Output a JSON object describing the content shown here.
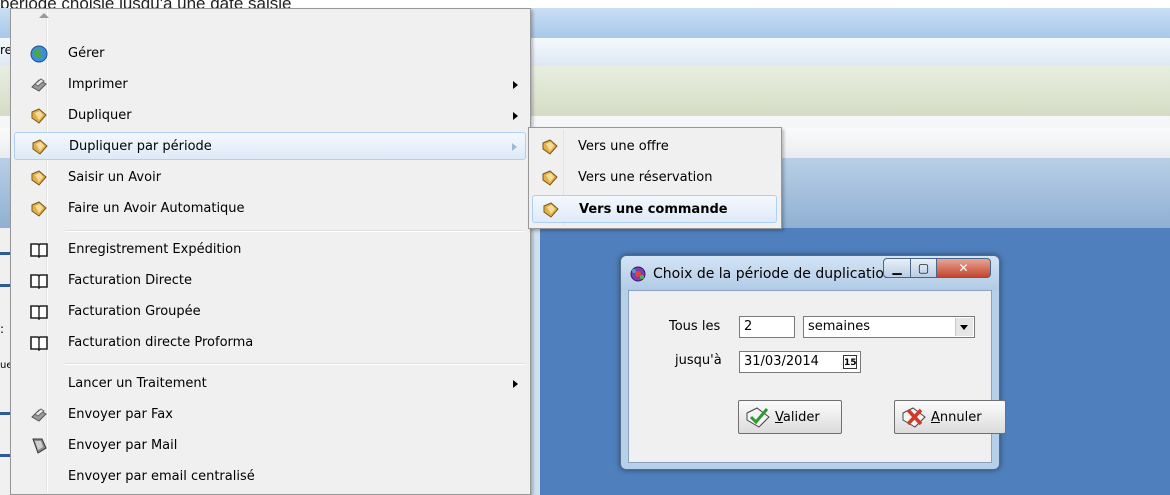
{
  "caption": "période choisie jusqu'à une date saisie",
  "background": {
    "left_fragments": [
      "re",
      ":",
      "ue"
    ]
  },
  "menu": {
    "items": [
      {
        "label": "Gérer",
        "icon": "globe-icon",
        "submenu": false
      },
      {
        "label": "Imprimer",
        "icon": "printer-icon",
        "submenu": true
      },
      {
        "label": "Dupliquer",
        "icon": "duplicate-icon",
        "submenu": true
      },
      {
        "label": "Dupliquer par période",
        "icon": "duplicate-icon",
        "submenu": true
      },
      {
        "label": "Saisir un Avoir",
        "icon": "duplicate-icon",
        "submenu": false
      },
      {
        "label": "Faire un Avoir Automatique",
        "icon": "duplicate-icon",
        "submenu": false
      },
      {
        "label": "Enregistrement Expédition",
        "icon": "book-icon",
        "submenu": false
      },
      {
        "label": "Facturation Directe",
        "icon": "book-icon",
        "submenu": false
      },
      {
        "label": "Facturation Groupée",
        "icon": "book-icon",
        "submenu": false
      },
      {
        "label": "Facturation directe Proforma",
        "icon": "book-icon",
        "submenu": false
      },
      {
        "label": "Lancer un Traitement",
        "icon": "",
        "submenu": true
      },
      {
        "label": "Envoyer par Fax",
        "icon": "fax-icon",
        "submenu": false
      },
      {
        "label": "Envoyer par Mail",
        "icon": "mail-icon",
        "submenu": false
      },
      {
        "label": "Envoyer par email centralisé",
        "icon": "",
        "submenu": false
      }
    ]
  },
  "submenu": {
    "items": [
      {
        "label": "Vers une offre",
        "icon": "duplicate-icon"
      },
      {
        "label": "Vers une réservation",
        "icon": "duplicate-icon"
      },
      {
        "label": "Vers une commande",
        "icon": "duplicate-icon"
      }
    ]
  },
  "dialog": {
    "title": "Choix de la période de duplication",
    "every_label": "Tous les",
    "every_value": "2",
    "unit_value": "semaines",
    "until_label": "jusqu'à",
    "until_value": "31/03/2014",
    "calendar_glyph": "15",
    "validate_label": "Valider",
    "validate_mnemonic": "V",
    "cancel_label": "Annuler",
    "cancel_mnemonic": "A",
    "colors": {
      "close": "#c4452c",
      "frame": "#b7d0ea"
    }
  }
}
